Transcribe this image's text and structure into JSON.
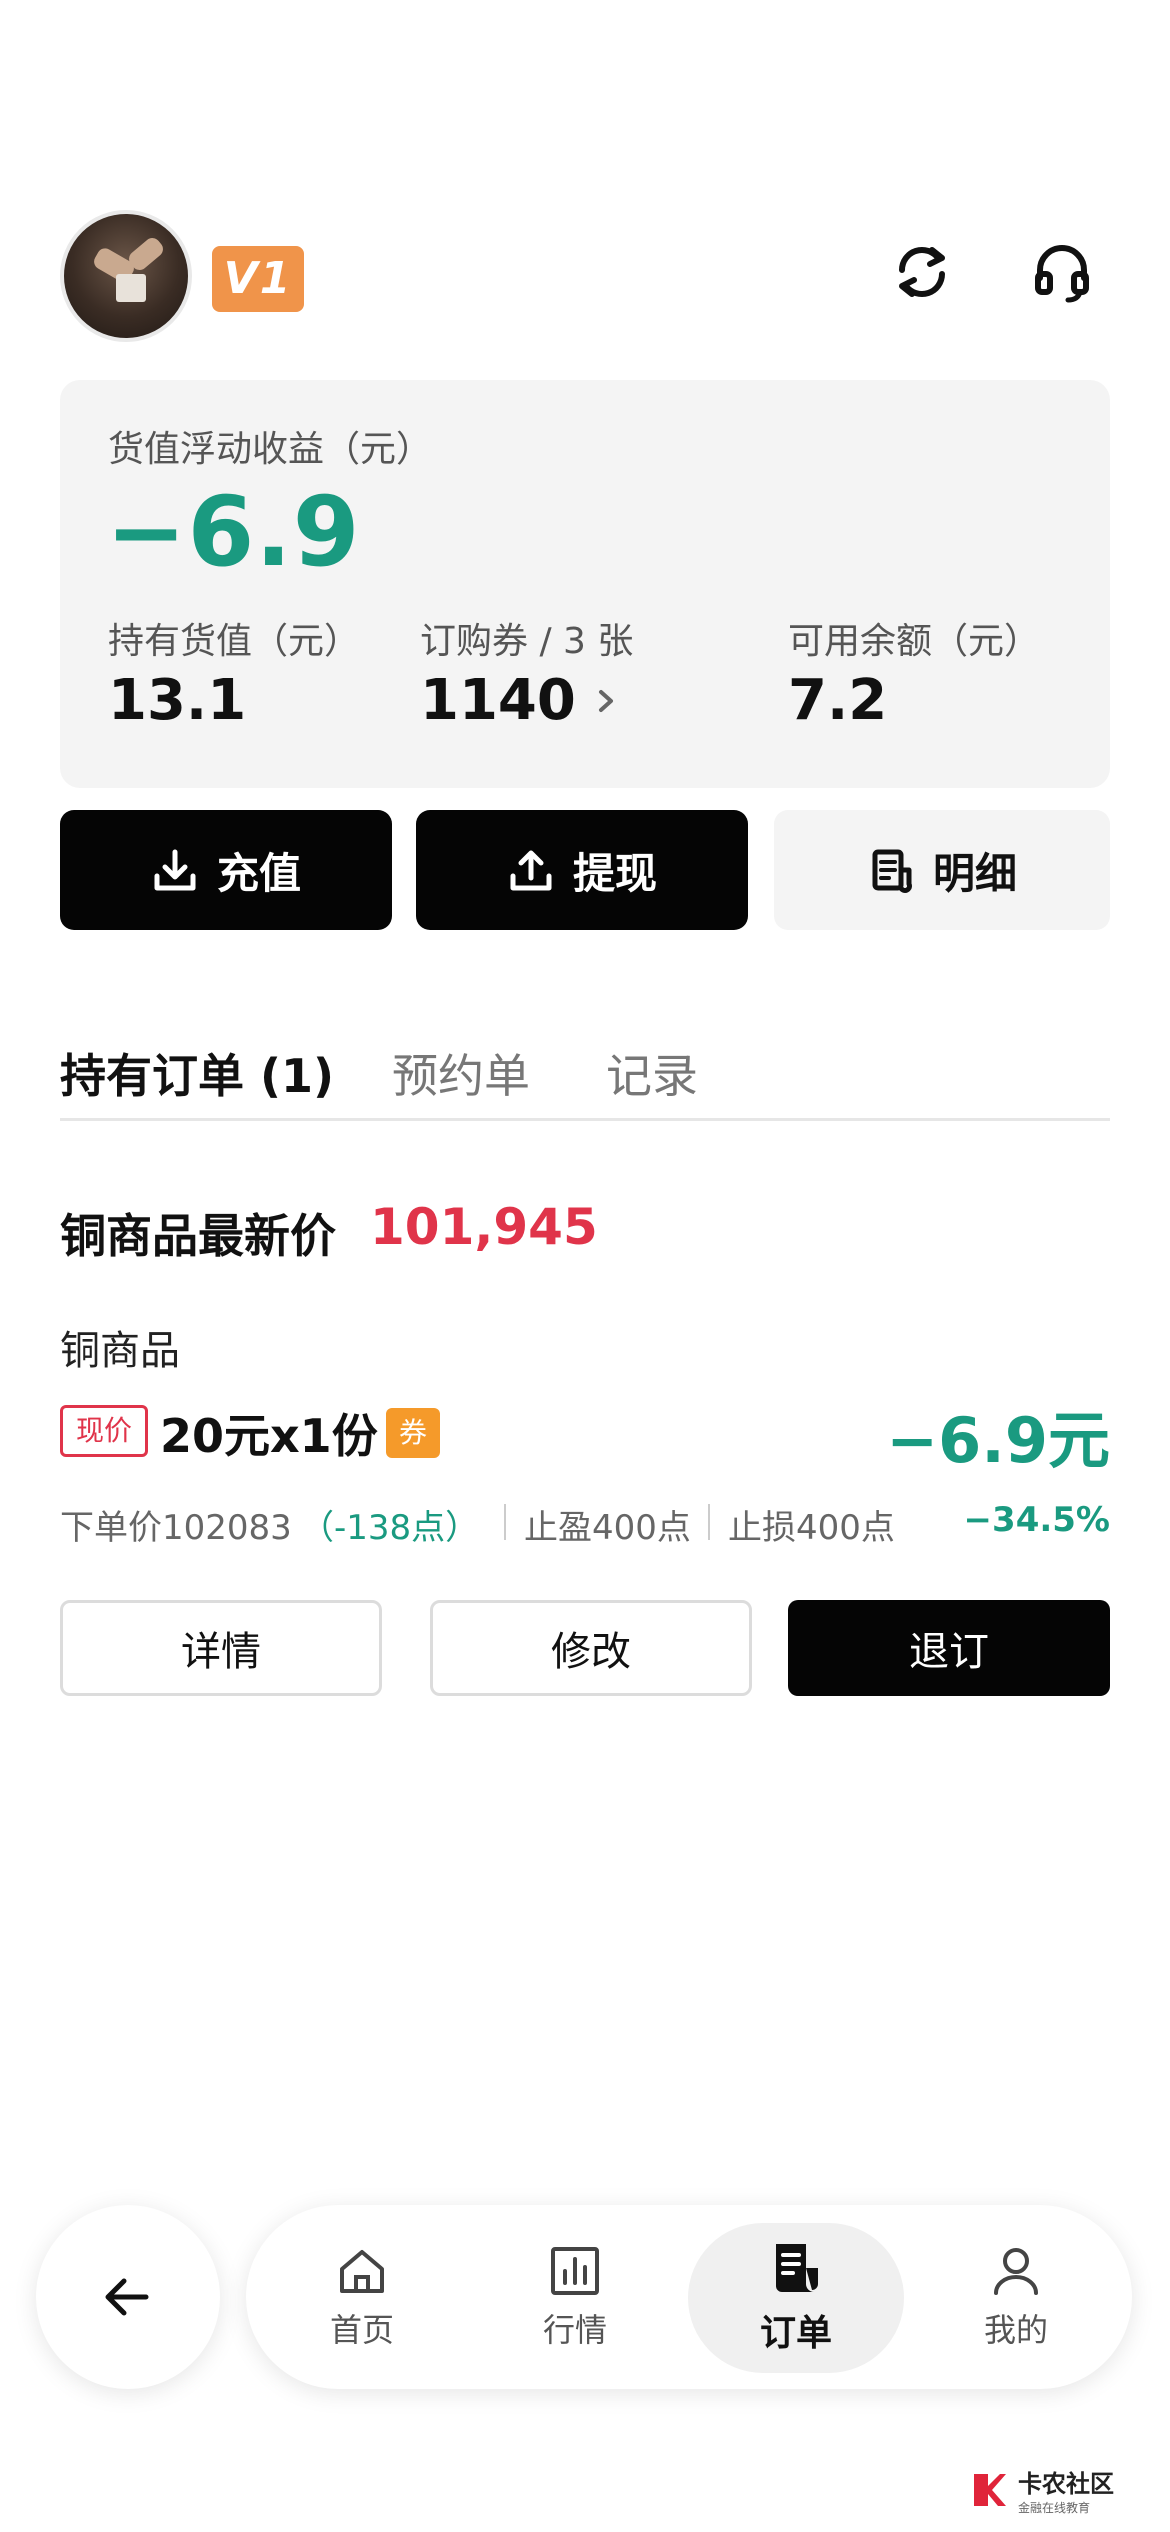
{
  "header": {
    "level_badge": "V1",
    "refresh_icon": "refresh-icon",
    "service_icon": "headset-icon"
  },
  "summary": {
    "floating_label": "货值浮动收益（元）",
    "floating_value": "−6.9",
    "holding_label": "持有货值（元）",
    "holding_value": "13.1",
    "coupon_label": "订购券 / 3 张",
    "coupon_value": "1140",
    "balance_label": "可用余额（元）",
    "balance_value": "7.2"
  },
  "actions": {
    "recharge": "充值",
    "withdraw": "提现",
    "details": "明细"
  },
  "tabs": [
    "持有订单 (1)",
    "预约单",
    "记录"
  ],
  "latest": {
    "title": "铜商品最新价",
    "price": "101,945"
  },
  "order": {
    "product": "铜商品",
    "tag_now": "现价",
    "spec": "20元x1份",
    "tag_coupon": "券",
    "pnl": "−6.9元",
    "order_price": "下单价102083",
    "points_diff": "（-138点）",
    "take_profit": "止盈400点",
    "stop_loss": "止损400点",
    "pct": "−34.5%",
    "btn_detail": "详情",
    "btn_modify": "修改",
    "btn_cancel": "退订"
  },
  "nav": {
    "items": [
      "首页",
      "行情",
      "订单",
      "我的"
    ],
    "active": "订单"
  },
  "watermark": {
    "title": "卡农社区",
    "subtitle": "金融在线教育"
  },
  "colors": {
    "green": "#1a9a80",
    "red": "#e0344a",
    "orange": "#f0944a",
    "dark": "#050505"
  }
}
